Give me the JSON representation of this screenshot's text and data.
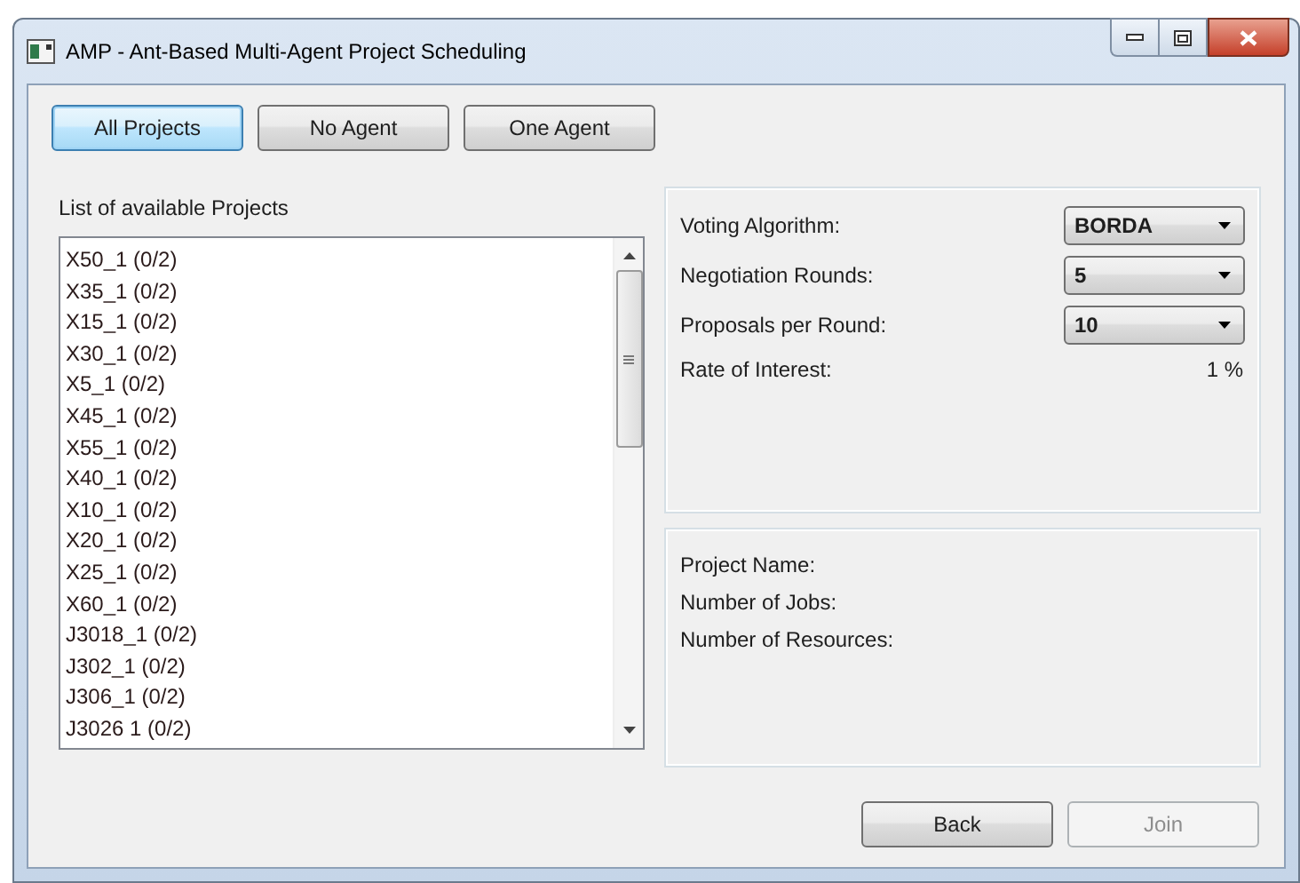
{
  "window": {
    "title": "AMP - Ant-Based Multi-Agent Project Scheduling"
  },
  "filter_buttons": [
    {
      "label": "All Projects",
      "selected": true
    },
    {
      "label": "No Agent",
      "selected": false
    },
    {
      "label": "One Agent",
      "selected": false
    }
  ],
  "project_list": {
    "label": "List of available Projects",
    "items": [
      "X50_1 (0/2)",
      "X35_1 (0/2)",
      "X15_1 (0/2)",
      "X30_1 (0/2)",
      "X5_1 (0/2)",
      "X45_1 (0/2)",
      "X55_1 (0/2)",
      "X40_1 (0/2)",
      "X10_1 (0/2)",
      "X20_1 (0/2)",
      "X25_1 (0/2)",
      "X60_1 (0/2)",
      "J3018_1 (0/2)",
      "J302_1 (0/2)",
      "J306_1 (0/2)",
      "J3026 1 (0/2)"
    ]
  },
  "settings": [
    {
      "kind": "dropdown",
      "label": "Voting Algorithm:",
      "value": "BORDA"
    },
    {
      "kind": "dropdown",
      "label": "Negotiation Rounds:",
      "value": "5"
    },
    {
      "kind": "dropdown",
      "label": "Proposals per Round:",
      "value": "10"
    },
    {
      "kind": "readout",
      "label": "Rate of Interest:",
      "value": "1 %"
    }
  ],
  "details": [
    "Project Name:",
    "Number of Jobs:",
    "Number of Resources:"
  ],
  "buttons": [
    {
      "label": "Back",
      "disabled": false
    },
    {
      "label": "Join",
      "disabled": true
    }
  ]
}
